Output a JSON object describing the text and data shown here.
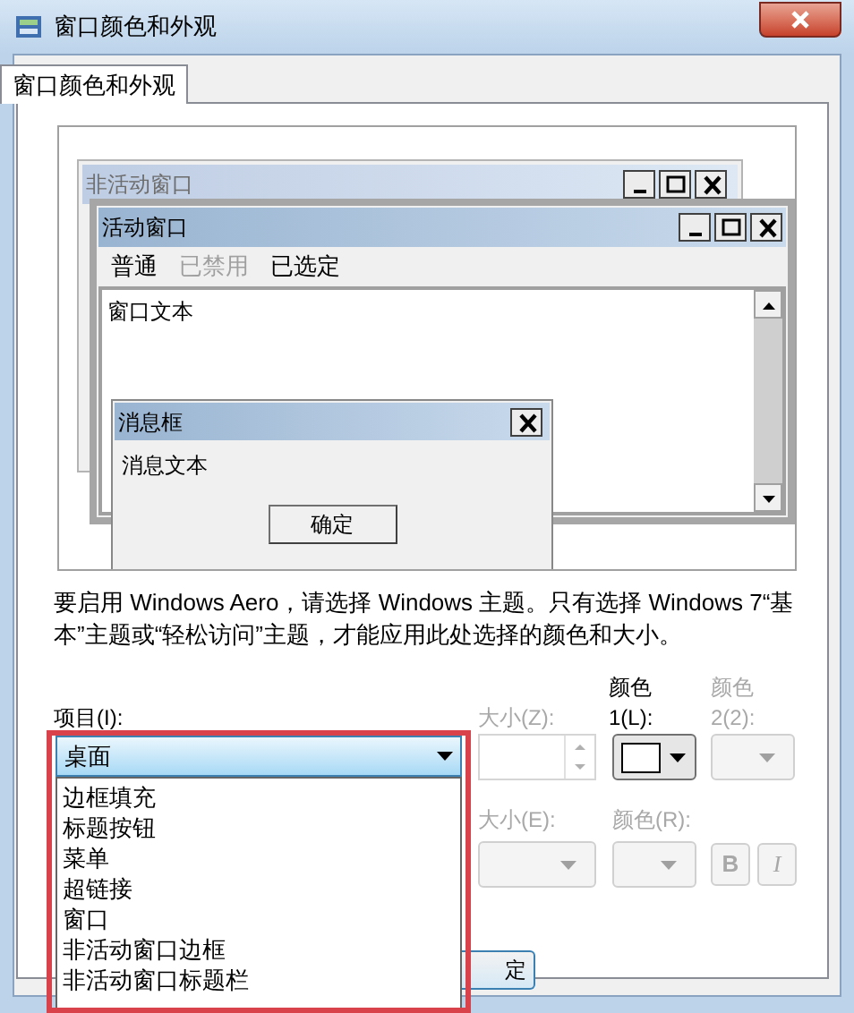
{
  "window": {
    "title": "窗口颜色和外观"
  },
  "tabs": [
    {
      "label": "窗口颜色和外观",
      "selected": true
    }
  ],
  "preview": {
    "inactive_window": {
      "title": "非活动窗口"
    },
    "active_window": {
      "title": "活动窗口",
      "menu": [
        {
          "label": "普通",
          "disabled": false
        },
        {
          "label": "已禁用",
          "disabled": true
        },
        {
          "label": "已选定",
          "disabled": false
        }
      ],
      "text": "窗口文本"
    },
    "message_box": {
      "title": "消息框",
      "text": "消息文本",
      "button": "确定"
    }
  },
  "description": "要启用 Windows Aero，请选择 Windows 主题。只有选择 Windows 7“基本”主题或“轻松访问”主题，才能应用此处选择的颜色和大小。",
  "item": {
    "label": "项目(I):",
    "value": "桌面",
    "expanded": true,
    "options": [
      {
        "label": "边框填充"
      },
      {
        "label": "标题按钮"
      },
      {
        "label": "菜单"
      },
      {
        "label": "超链接"
      },
      {
        "label": "窗口"
      },
      {
        "label": "非活动窗口边框"
      },
      {
        "label": "非活动窗口标题栏"
      }
    ]
  },
  "size1": {
    "label": "大小(Z):",
    "disabled": true
  },
  "color1": {
    "label": "颜色 1(L):",
    "disabled": false
  },
  "color2": {
    "label": "颜色 2(2):",
    "disabled": true
  },
  "size2": {
    "label": "大小(E):",
    "disabled": true
  },
  "font_color": {
    "label": "颜色(R):",
    "disabled": true
  },
  "bold": {
    "label": "B",
    "disabled": true
  },
  "italic": {
    "label": "I",
    "disabled": true
  },
  "ok_button": {
    "label": "定"
  }
}
